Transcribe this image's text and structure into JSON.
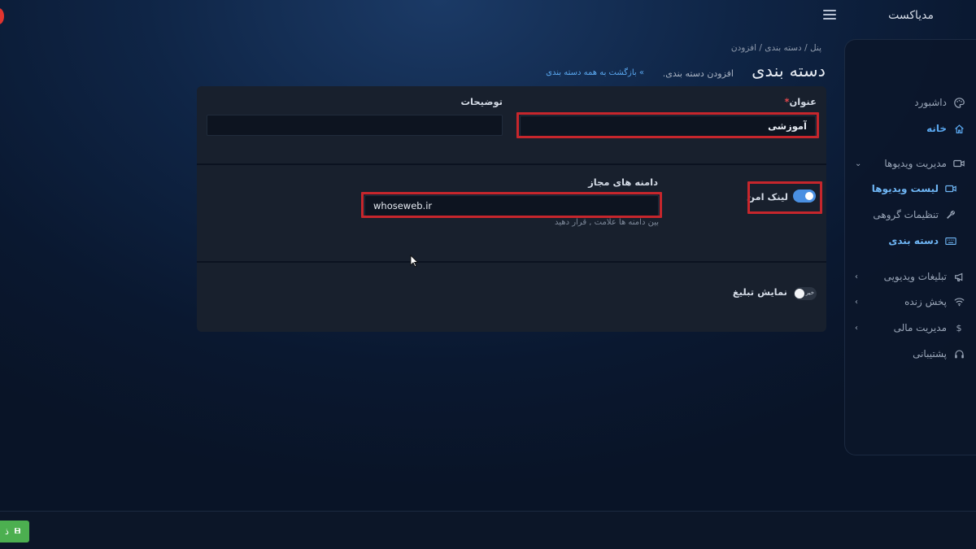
{
  "header": {
    "brand": "مدیاکست"
  },
  "sidebar": {
    "items": [
      {
        "label": "داشبورد",
        "icon": "palette-icon"
      },
      {
        "label": "خانه",
        "icon": "home-icon"
      },
      {
        "label": "مدیریت ویدیوها",
        "icon": "video-icon"
      },
      {
        "label": "لیست ویدیوها",
        "icon": "video-icon"
      },
      {
        "label": "تنظیمات گروهی",
        "icon": "wrench-icon"
      },
      {
        "label": "دسته بندی",
        "icon": "keyboard-icon"
      },
      {
        "label": "تبلیغات ویدیویی",
        "icon": "megaphone-icon"
      },
      {
        "label": "پخش زنده",
        "icon": "wifi-icon"
      },
      {
        "label": "مدیریت مالی",
        "icon": "dollar-icon"
      },
      {
        "label": "پشتیبانی",
        "icon": "headset-icon"
      }
    ]
  },
  "breadcrumb": {
    "text": "پنل  /  دسته بندی  /  افزودن"
  },
  "page": {
    "title": "دسته بندی",
    "subtitle": "افزودن دسته بندی.",
    "back_link": "» بازگشت به همه دسته بندی"
  },
  "form": {
    "title_label": "عنوان",
    "required_mark": "*",
    "title_value": "آموزشی",
    "description_label": "توضیحات",
    "description_value": "",
    "secure_link_label": "لینک امن",
    "secure_link_on": true,
    "domains_label": "دامنه های مجاز",
    "domains_value": "whoseweb.ir",
    "domains_hint": "بین دامنه ها علامت , قرار دهید",
    "show_ad_label": "نمایش تبلیغ",
    "show_ad_on": false,
    "show_ad_off_text": "خیر"
  },
  "footer": {
    "save_label": "ذ"
  },
  "colors": {
    "accent": "#4a90e2",
    "highlight": "#c6262c",
    "save": "#4caf50",
    "active_link": "#5aa8f0"
  }
}
